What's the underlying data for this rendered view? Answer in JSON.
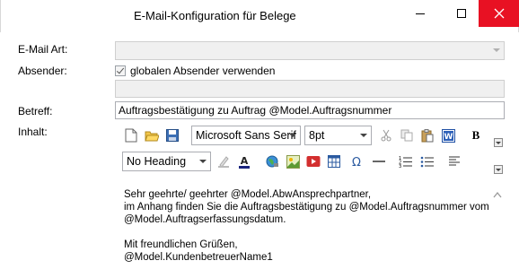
{
  "window": {
    "title": "E-Mail-Konfiguration für Belege"
  },
  "labels": {
    "email_art": "E-Mail Art:",
    "absender": "Absender:",
    "betreff": "Betreff:",
    "inhalt": "Inhalt:"
  },
  "email_art": {
    "value": ""
  },
  "absender": {
    "checkbox_label": "globalen Absender verwenden",
    "checked": true,
    "value": ""
  },
  "betreff": {
    "value": "Auftragsbestätigung zu Auftrag @Model.Auftragsnummer"
  },
  "toolbar": {
    "font": "Microsoft Sans Serif",
    "size": "8pt",
    "heading": "No Heading",
    "bold_label": "B"
  },
  "editor": {
    "lines": [
      "Sehr geehrte/ geehrter @Model.AbwAnsprechpartner,",
      "im Anhang finden Sie die Auftragsbestätigung zu @Model.Auftragsnummer vom",
      "@Model.Auftragserfassungsdatum.",
      "",
      "Mit freundlichen Grüßen,",
      "@Model.KundenbetreuerName1"
    ]
  },
  "colors": {
    "close_button": "#e81123",
    "input_border": "#abadb3",
    "disabled_field": "#f0f0f0"
  }
}
